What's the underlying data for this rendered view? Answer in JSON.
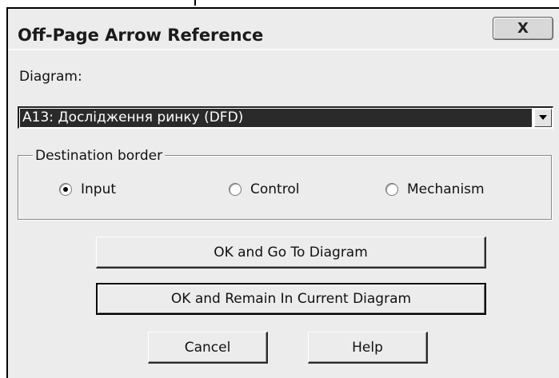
{
  "dialog": {
    "title": "Off-Page Arrow Reference",
    "close_glyph": "X",
    "close_icon": "close-icon"
  },
  "diagram": {
    "label": "Diagram:",
    "selected": "A13:  Дослідження ринку (DFD)",
    "dropdown_icon": "chevron-down-icon"
  },
  "destination": {
    "legend": "Destination border",
    "options": [
      {
        "label": "Input",
        "checked": true
      },
      {
        "label": "Control",
        "checked": false
      },
      {
        "label": "Mechanism",
        "checked": false
      }
    ]
  },
  "buttons": {
    "ok_go": "OK and Go To Diagram",
    "ok_remain": "OK and Remain In Current Diagram",
    "cancel": "Cancel",
    "help": "Help"
  },
  "colors": {
    "selection_bg": "#2a2a2a",
    "dialog_bg": "#ececec"
  }
}
